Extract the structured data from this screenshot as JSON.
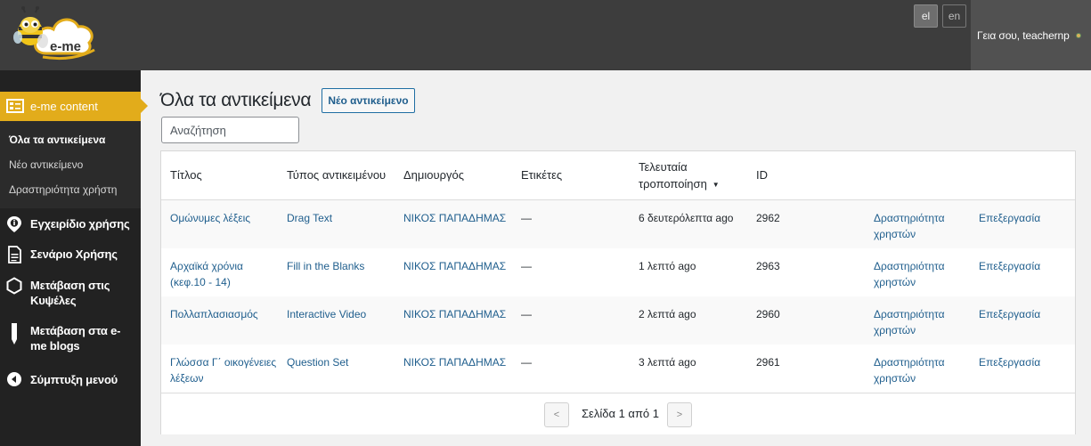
{
  "header": {
    "logo_text": "e-me",
    "languages": [
      "el",
      "en"
    ],
    "user_greeting": "Γεια σου, teachernp"
  },
  "sidebar": {
    "active_section": "e-me content",
    "subitems": [
      "Όλα τα αντικείμενα",
      "Νέο αντικείμενο",
      "Δραστηριότητα χρήστη"
    ],
    "items": [
      {
        "label": "Εγχειρίδιο χρήσης",
        "icon": "info-pin-icon"
      },
      {
        "label": "Σενάριο Χρήσης",
        "icon": "document-icon"
      },
      {
        "label": "Μετάβαση στις Κυψέλες",
        "icon": "hexagon-icon"
      },
      {
        "label": "Μετάβαση στα e-me blogs",
        "icon": "pencil-icon"
      },
      {
        "label": "Σύμπτυξη μενού",
        "icon": "collapse-arrow-icon"
      }
    ]
  },
  "main": {
    "title": "Όλα τα αντικείμενα",
    "new_button": "Νέο αντικείμενο",
    "search_placeholder": "Αναζήτηση",
    "columns": {
      "title": "Τίτλος",
      "type": "Τύπος αντικειμένου",
      "creator": "Δημιουργός",
      "tags": "Ετικέτες",
      "modified": "Τελευταία τροποποίηση",
      "sort_indicator": "▼",
      "id": "ID"
    },
    "rows": [
      {
        "title": "Ομώνυμες λέξεις",
        "type": "Drag Text",
        "creator": "ΝΙΚΟΣ ΠΑΠΑΔΗΜΑΣ",
        "tags": "—",
        "modified": "6 δευτερόλεπτα ago",
        "id": "2962",
        "activity": "Δραστηριότητα χρηστών",
        "edit": "Επεξεργασία"
      },
      {
        "title": "Αρχαϊκά χρόνια (κεφ.10 - 14)",
        "type": "Fill in the Blanks",
        "creator": "ΝΙΚΟΣ ΠΑΠΑΔΗΜΑΣ",
        "tags": "—",
        "modified": "1 λεπτό ago",
        "id": "2963",
        "activity": "Δραστηριότητα χρηστών",
        "edit": "Επεξεργασία"
      },
      {
        "title": "Πολλαπλασιασμός",
        "type": "Interactive Video",
        "creator": "ΝΙΚΟΣ ΠΑΠΑΔΗΜΑΣ",
        "tags": "—",
        "modified": "2 λεπτά ago",
        "id": "2960",
        "activity": "Δραστηριότητα χρηστών",
        "edit": "Επεξεργασία"
      },
      {
        "title": "Γλώσσα Γ΄ οικογένειες λέξεων",
        "type": "Question Set",
        "creator": "ΝΙΚΟΣ ΠΑΠΑΔΗΜΑΣ",
        "tags": "—",
        "modified": "3 λεπτά ago",
        "id": "2961",
        "activity": "Δραστηριότητα χρηστών",
        "edit": "Επεξεργασία"
      }
    ],
    "pagination": {
      "prev": "<",
      "next": ">",
      "text": "Σελίδα 1 από 1"
    }
  },
  "colors": {
    "topbar": "#3d3d3d",
    "sidebar": "#222222",
    "accent": "#e2ac1b",
    "link": "#1f5e8d"
  }
}
